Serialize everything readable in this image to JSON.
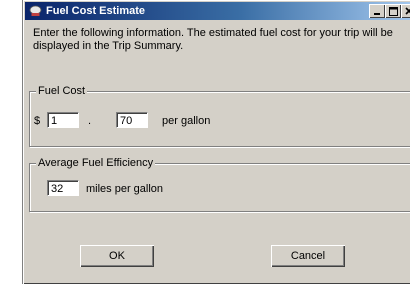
{
  "window": {
    "title": "Fuel Cost Estimate",
    "controls": {
      "minimize": "minimize-icon",
      "maximize": "maximize-icon",
      "close": "close-icon"
    }
  },
  "intro_text": "Enter the following information.  The estimated fuel cost for your trip will be displayed in the Trip Summary.",
  "fuel_cost": {
    "legend": "Fuel Cost",
    "currency_symbol": "$",
    "dollars_value": "1",
    "separator": ".",
    "cents_value": "70",
    "unit_label": "per gallon"
  },
  "fuel_efficiency": {
    "legend": "Average Fuel Efficiency",
    "mpg_value": "32",
    "unit_label": "miles per gallon"
  },
  "buttons": {
    "ok": "OK",
    "cancel": "Cancel"
  },
  "colors": {
    "title_bar": "#0a246a",
    "dialog_face": "#d4d0c8"
  }
}
